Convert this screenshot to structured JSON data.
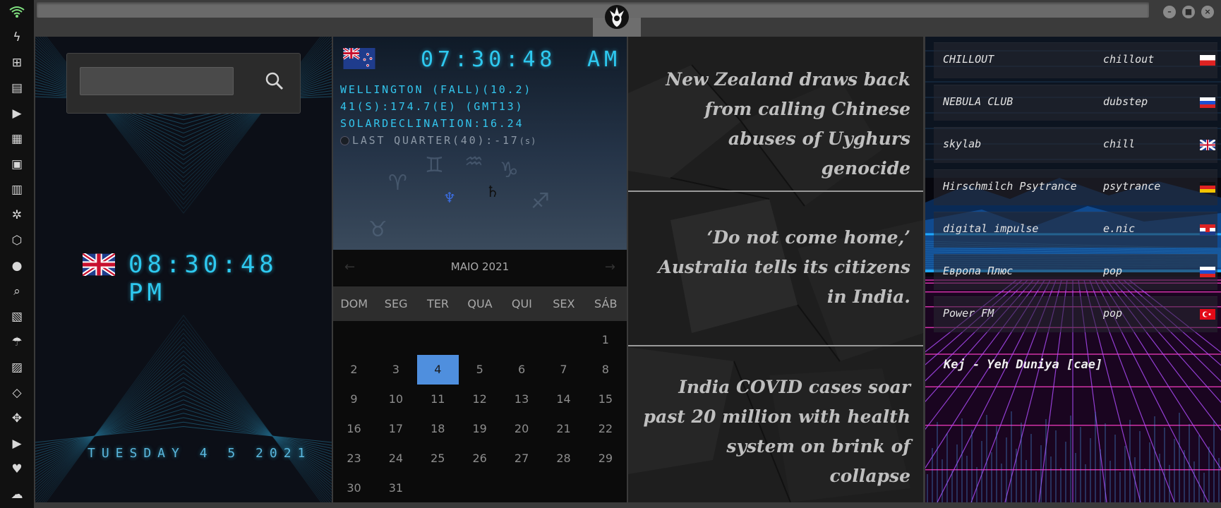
{
  "rail": {
    "items": [
      "wifi-icon",
      "bolt-icon",
      "windows-icon",
      "archive-icon",
      "play-icon",
      "map-book-icon",
      "image-icon",
      "newspaper-icon",
      "gear-icon",
      "hexagon-icon",
      "globe-icon",
      "search-icon",
      "map-icon",
      "umbrella-icon",
      "contacts-icon",
      "code-icon",
      "expand-icon",
      "youtube-icon",
      "heart-icon",
      "cloud-icon"
    ]
  },
  "window": {
    "min": "–",
    "max": "■",
    "close": "×"
  },
  "clock_panel": {
    "search_placeholder": "",
    "time": "08:30:48 PM",
    "date": "TUESDAY 4 5 2021"
  },
  "world_panel": {
    "time": "07:30:48",
    "ampm": "AM",
    "line1": "WELLINGTON (FALL)(10.2)",
    "line2": "41(S):174.7(E) (GMT13)",
    "line3": "SOLARDECLINATION:16.24",
    "moon": "LAST QUARTER(40):-17",
    "moon_suffix": "(s)",
    "neptune": "♆",
    "saturn": "♄",
    "calendar": {
      "prev": "←",
      "next": "→",
      "title": "MAIO 2021",
      "days": [
        "DOM",
        "SEG",
        "TER",
        "QUA",
        "QUI",
        "SEX",
        "SÁB"
      ],
      "first_col": 6,
      "num_days": 31,
      "selected": 4
    }
  },
  "news": {
    "items": [
      "New Zealand draws back from calling Chinese abuses of Uyghurs genocide",
      "‘Do not come home,’ Australia tells its citizens in India.",
      "India COVID cases soar past 20 million with health system on brink of collapse"
    ]
  },
  "radio": {
    "stations": [
      {
        "name": "CHILLOUT",
        "genre": "chillout",
        "flag": "poland"
      },
      {
        "name": "NEBULA CLUB",
        "genre": "dubstep",
        "flag": "russia"
      },
      {
        "name": "skylab",
        "genre": "chill",
        "flag": "uk"
      },
      {
        "name": "Hirschmilch Psytrance",
        "genre": "psytrance",
        "flag": "germany"
      },
      {
        "name": "digital impulse",
        "genre": "e.nic",
        "flag": "croatia"
      },
      {
        "name": "Европа Плюс",
        "genre": "pop",
        "flag": "russia"
      },
      {
        "name": "Power FM",
        "genre": "pop",
        "flag": "turkey"
      }
    ],
    "now_playing": "Kej - Yeh Duniya [cae]"
  },
  "colors": {
    "accent_cyan": "#2ec9f0",
    "calendar_selected": "#4f8fde",
    "neon_pink": "#ff3cc8",
    "neon_blue": "#1fa8ff"
  }
}
